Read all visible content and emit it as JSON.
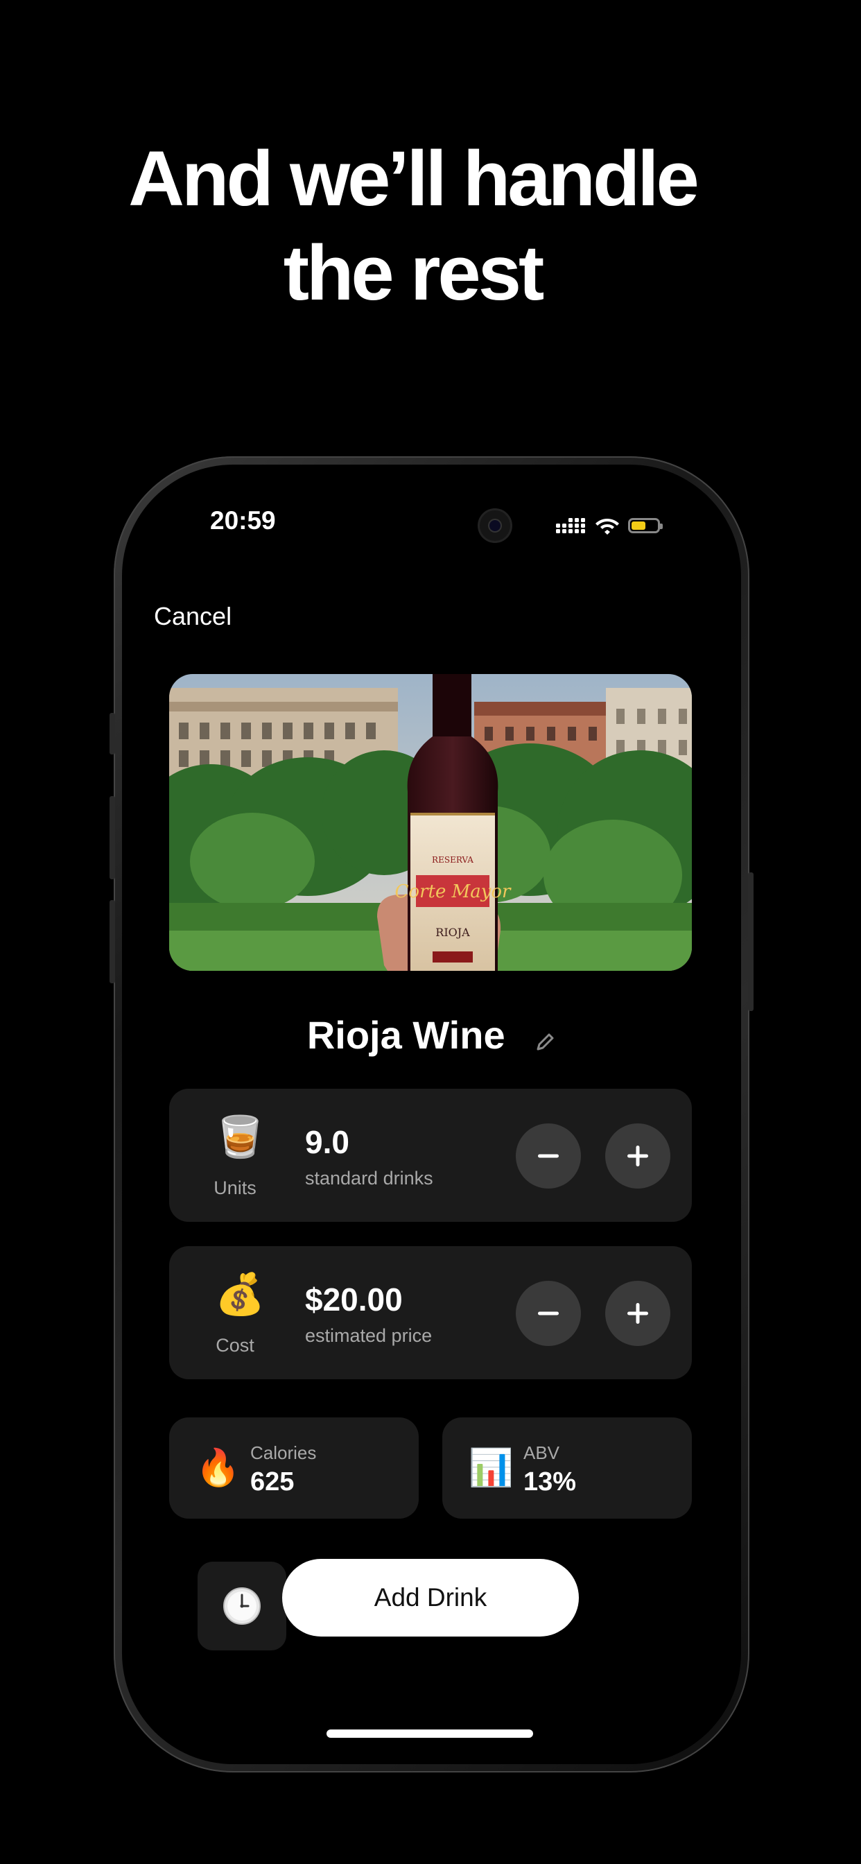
{
  "headline": {
    "line1": "And we’ll handle",
    "line2": "the rest"
  },
  "status_bar": {
    "time": "20:59",
    "icons": [
      "cellular-signal-icon",
      "wifi-icon",
      "battery-icon"
    ],
    "battery_level": 0.55,
    "battery_color": "#f2cc17"
  },
  "nav": {
    "cancel_label": "Cancel"
  },
  "drink": {
    "name": "Rioja Wine",
    "photo_icon": "wine-bottle-photo"
  },
  "units_card": {
    "icon": "🥃",
    "label": "Units",
    "value": "9.0",
    "sub": "standard drinks"
  },
  "cost_card": {
    "icon": "💰",
    "label": "Cost",
    "value": "$20.00",
    "sub": "estimated price"
  },
  "calories_card": {
    "icon": "🔥",
    "label": "Calories",
    "value": "625"
  },
  "abv_card": {
    "icon": "📊",
    "label": "ABV",
    "value": "13%"
  },
  "actions": {
    "time_icon": "🕐",
    "add_label": "Add Drink"
  },
  "colors": {
    "background": "#000000",
    "card": "#1b1b1b",
    "button": "#3a3a3a",
    "accent": "#ffffff"
  }
}
